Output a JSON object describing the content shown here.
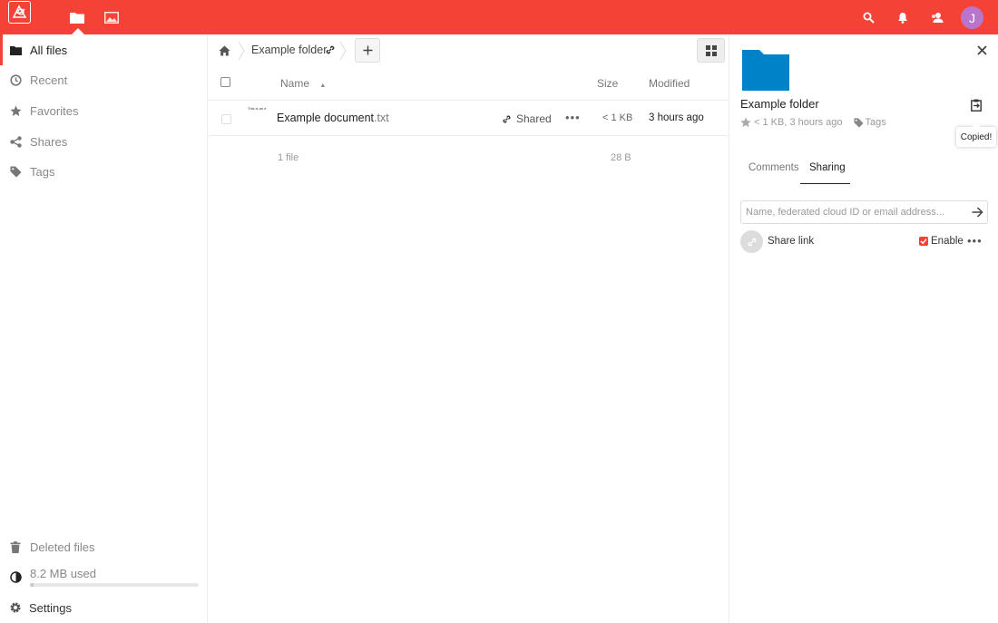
{
  "header": {
    "avatar_initial": "J",
    "accent": "#f44336"
  },
  "sidebar": {
    "items": [
      {
        "label": "All files",
        "icon": "folder-icon"
      },
      {
        "label": "Recent",
        "icon": "clock-icon"
      },
      {
        "label": "Favorites",
        "icon": "star-icon"
      },
      {
        "label": "Shares",
        "icon": "share-icon"
      },
      {
        "label": "Tags",
        "icon": "tag-icon"
      }
    ],
    "deleted_label": "Deleted files",
    "quota_label": "8.2 MB used",
    "quota_fraction": 0.02,
    "settings_label": "Settings"
  },
  "breadcrumb": {
    "folder": "Example folder"
  },
  "table": {
    "columns": {
      "name": "Name",
      "size": "Size",
      "modified": "Modified"
    },
    "rows": [
      {
        "thumb_text": "This is an e",
        "name": "Example document",
        "ext": ".txt",
        "shared_label": "Shared",
        "size": "< 1 KB",
        "modified": "3 hours ago"
      }
    ],
    "summary": {
      "count": "1 file",
      "size": "28 B"
    }
  },
  "details": {
    "title": "Example folder",
    "meta": "< 1 KB, 3 hours ago",
    "tags_label": "Tags",
    "tooltip": "Copied!",
    "tabs": [
      "Comments",
      "Sharing"
    ],
    "active_tab": "Sharing",
    "share_placeholder": "Name, federated cloud ID or email address...",
    "share_link_label": "Share link",
    "enable_label": "Enable",
    "folder_color": "#0082c9"
  }
}
